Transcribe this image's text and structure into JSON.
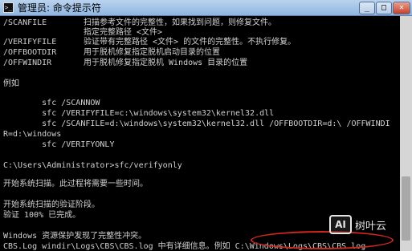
{
  "window": {
    "title": "管理员: 命令提示符"
  },
  "lines": [
    {
      "opt": "/SCANFILE",
      "desc": "扫描参考文件的完整性，如果找到问题，则修复文件。"
    },
    {
      "opt": "",
      "desc": "指定完整路径 <文件>"
    },
    {
      "opt": "/VERIFYFILE",
      "desc": "验证带有完整路径 <文件> 的文件的完整性。不执行修复。"
    },
    {
      "opt": "/OFFBOOTDIR",
      "desc": "用于脱机修复指定脱机启动目录的位置"
    },
    {
      "opt": "/OFFWINDIR",
      "desc": "用于脱机修复指定脱机 Windows 目录的位置"
    },
    {
      "text": ""
    },
    {
      "text": "例如"
    },
    {
      "text": ""
    },
    {
      "text": "        sfc /SCANNOW"
    },
    {
      "text": "        sfc /VERIFYFILE=c:\\windows\\system32\\kernel32.dll"
    },
    {
      "text": "        sfc /SCANFILE=d:\\windows\\system32\\kernel32.dll /OFFBOOTDIR=d:\\ /OFFWINDI"
    },
    {
      "text": "R=d:\\windows"
    },
    {
      "text": "        sfc /VERIFYONLY"
    },
    {
      "text": ""
    },
    {
      "text": "C:\\Users\\Administrator>sfc/verifyonly"
    },
    {
      "text": ""
    },
    {
      "text": "开始系统扫描。此过程将需要一些时间。"
    },
    {
      "text": ""
    },
    {
      "text": "开始系统扫描的验证阶段。"
    },
    {
      "text": "验证 100% 已完成。"
    },
    {
      "text": ""
    },
    {
      "text": "Windows 资源保护发现了完整性冲突。"
    },
    {
      "text": "CBS.Log windir\\Logs\\CBS\\CBS.log 中有详细信息。例如 C:\\Windows\\Logs\\CBS\\CBS.log"
    }
  ],
  "watermark": {
    "logo": "AI",
    "text": "树叶云"
  },
  "icons": {
    "app": "cmd-icon",
    "minimize": "minimize-icon",
    "maximize": "maximize-icon",
    "close": "close-icon"
  }
}
